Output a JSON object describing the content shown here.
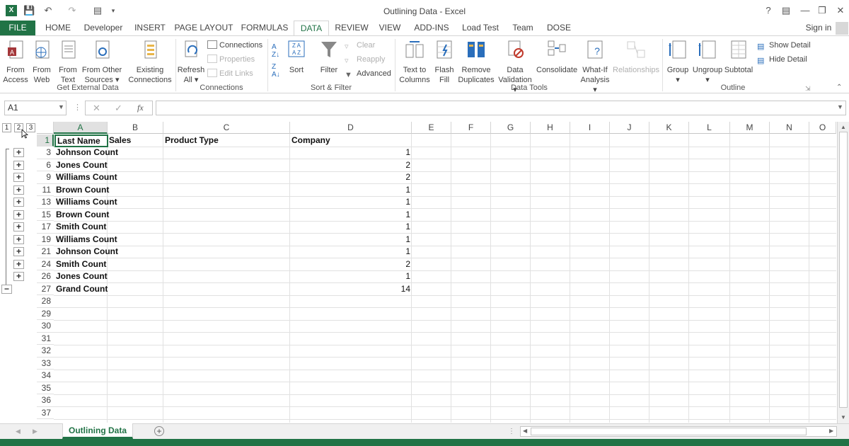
{
  "window": {
    "title": "Outlining Data - Excel"
  },
  "qat": {
    "undo_icon": "undo-icon",
    "redo_icon": "redo-icon"
  },
  "tabs": [
    {
      "label": "FILE"
    },
    {
      "label": "HOME"
    },
    {
      "label": "Developer"
    },
    {
      "label": "INSERT"
    },
    {
      "label": "PAGE LAYOUT"
    },
    {
      "label": "FORMULAS"
    },
    {
      "label": "DATA"
    },
    {
      "label": "REVIEW"
    },
    {
      "label": "VIEW"
    },
    {
      "label": "ADD-INS"
    },
    {
      "label": "Load Test"
    },
    {
      "label": "Team"
    },
    {
      "label": "DOSE"
    }
  ],
  "sign_in": "Sign in",
  "ribbon": {
    "get_external": {
      "from_access_1": "From",
      "from_access_2": "Access",
      "from_web_1": "From",
      "from_web_2": "Web",
      "from_text_1": "From",
      "from_text_2": "Text",
      "from_other_1": "From Other",
      "from_other_2": "Sources",
      "existing_1": "Existing",
      "existing_2": "Connections",
      "label": "Get External Data"
    },
    "connections": {
      "refresh_1": "Refresh",
      "refresh_2": "All",
      "connections": "Connections",
      "properties": "Properties",
      "edit_links": "Edit Links",
      "label": "Connections"
    },
    "sort_filter": {
      "sort": "Sort",
      "filter": "Filter",
      "clear": "Clear",
      "reapply": "Reapply",
      "advanced": "Advanced",
      "label": "Sort & Filter"
    },
    "data_tools": {
      "text_to_columns_1": "Text to",
      "text_to_columns_2": "Columns",
      "flash_fill_1": "Flash",
      "flash_fill_2": "Fill",
      "remove_dup_1": "Remove",
      "remove_dup_2": "Duplicates",
      "validation_1": "Data",
      "validation_2": "Validation",
      "consolidate": "Consolidate",
      "whatif_1": "What-If",
      "whatif_2": "Analysis",
      "relationships": "Relationships",
      "label": "Data Tools"
    },
    "outline": {
      "group": "Group",
      "ungroup": "Ungroup",
      "subtotal": "Subtotal",
      "show_detail": "Show Detail",
      "hide_detail": "Hide Detail",
      "label": "Outline"
    }
  },
  "formula_bar": {
    "name_box": "A1",
    "fx": "fx",
    "formula": ""
  },
  "columns": [
    "A",
    "B",
    "C",
    "D",
    "E",
    "F",
    "G",
    "H",
    "I",
    "J",
    "K",
    "L",
    "M",
    "N",
    "O"
  ],
  "outline_levels": [
    "1",
    "2",
    "3"
  ],
  "header_row": {
    "row": "1",
    "a": "Last Name",
    "b": "Sales",
    "c": "Product Type",
    "d": "Company"
  },
  "rows": [
    {
      "row": "3",
      "name": "Johnson Count",
      "count": "1"
    },
    {
      "row": "6",
      "name": "Jones Count",
      "count": "2"
    },
    {
      "row": "9",
      "name": "Williams Count",
      "count": "2"
    },
    {
      "row": "11",
      "name": "Brown Count",
      "count": "1"
    },
    {
      "row": "13",
      "name": "Williams Count",
      "count": "1"
    },
    {
      "row": "15",
      "name": "Brown Count",
      "count": "1"
    },
    {
      "row": "17",
      "name": "Smith Count",
      "count": "1"
    },
    {
      "row": "19",
      "name": "Williams Count",
      "count": "1"
    },
    {
      "row": "21",
      "name": "Johnson Count",
      "count": "1"
    },
    {
      "row": "24",
      "name": "Smith Count",
      "count": "2"
    },
    {
      "row": "26",
      "name": "Jones Count",
      "count": "1"
    },
    {
      "row": "27",
      "name": "Grand Count",
      "count": "14"
    }
  ],
  "empty_rows": [
    "28",
    "29",
    "30",
    "31",
    "32",
    "33",
    "34",
    "35",
    "36",
    "37"
  ],
  "sheet_tab": "Outlining Data"
}
